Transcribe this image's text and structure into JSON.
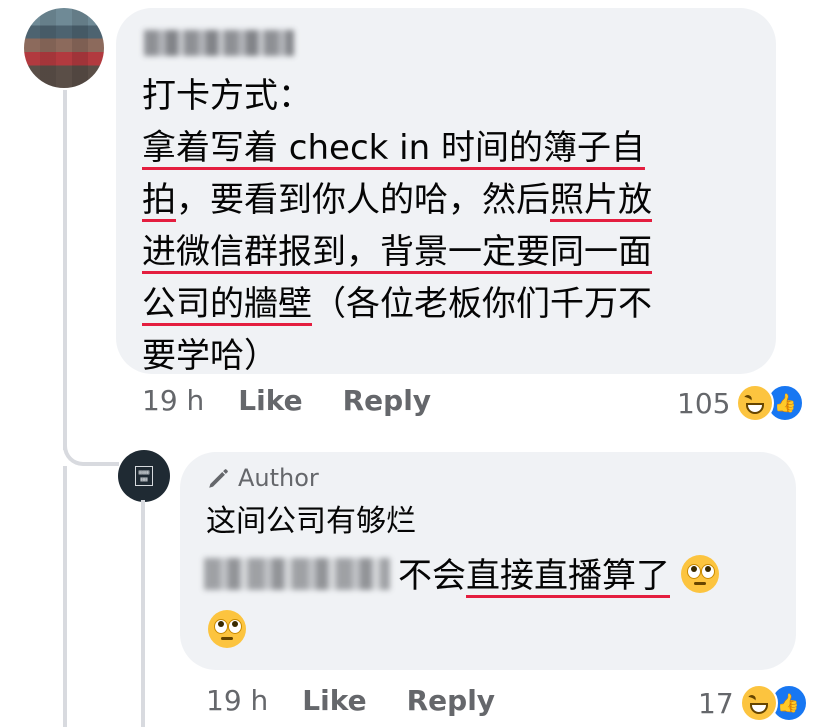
{
  "comment": {
    "author_label": "[redacted name]",
    "lines": [
      "打卡方式：",
      "拿着写着 check in 时间的簿子自",
      "拍，要看到你人的哈，然后照片放",
      "进微信群报到，背景一定要同一面",
      "公司的牆壁（各位老板你们千万不",
      "要学哈）"
    ],
    "line2_underlined": "拿着写着 check in 时间的簿子自",
    "line3_u1": "拍",
    "line3_mid": "，要看到你人的哈，然后",
    "line3_u2": "照片放",
    "line4_underlined": "进微信群报到，背景一定要同一面",
    "line5_underlined": "公司的牆壁",
    "line5_rest": "（各位老板你们千万不",
    "time": "19 h",
    "like_label": "Like",
    "reply_label": "Reply",
    "reaction_count": "105",
    "reaction_icons": [
      "haha-emoji",
      "like-emoji"
    ]
  },
  "reply": {
    "badge_label": "Author",
    "badge_icon": "pencil-icon",
    "line1": "这间公司有够烂",
    "mention_label": "[redacted name]",
    "line2_plain": "不会",
    "line2_underlined": "直接直播算了",
    "trailing_emoji": "eye-roll-emoji",
    "time": "19 h",
    "like_label": "Like",
    "reply_label": "Reply",
    "reaction_count": "17",
    "reaction_icons": [
      "haha-emoji",
      "like-emoji"
    ]
  },
  "colors": {
    "bubble_bg": "#f0f2f5",
    "meta_text": "#65676b",
    "spellcheck_underline": "#e41e3f",
    "like_blue": "#1877f2"
  }
}
